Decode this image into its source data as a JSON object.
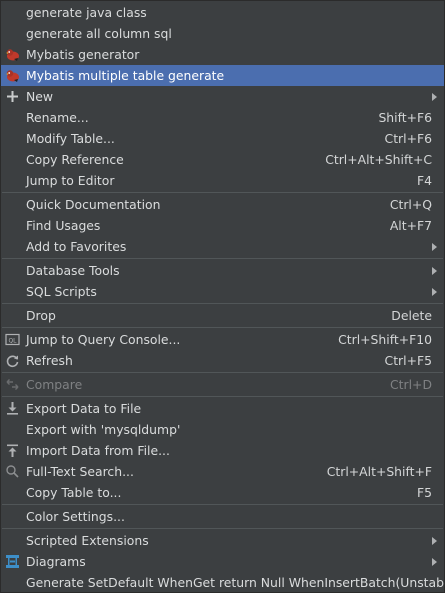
{
  "menu": {
    "items": [
      {
        "label": "generate java class",
        "shortcut": "",
        "icon": "",
        "submenu": false
      },
      {
        "label": "generate all column sql",
        "shortcut": "",
        "icon": "",
        "submenu": false
      },
      {
        "label": "Mybatis generator",
        "shortcut": "",
        "icon": "mybatis-bird-icon",
        "submenu": false
      },
      {
        "label": "Mybatis multiple table generate",
        "shortcut": "",
        "icon": "mybatis-bird-icon",
        "submenu": false,
        "selected": true
      },
      {
        "label": "New",
        "shortcut": "",
        "icon": "plus-icon",
        "submenu": true
      },
      {
        "label": "Rename...",
        "shortcut": "Shift+F6",
        "icon": "",
        "submenu": false
      },
      {
        "label": "Modify Table...",
        "shortcut": "Ctrl+F6",
        "icon": "",
        "submenu": false
      },
      {
        "label": "Copy Reference",
        "shortcut": "Ctrl+Alt+Shift+C",
        "icon": "",
        "submenu": false
      },
      {
        "label": "Jump to Editor",
        "shortcut": "F4",
        "icon": "",
        "submenu": false
      },
      {
        "label": "Quick Documentation",
        "shortcut": "Ctrl+Q",
        "icon": "",
        "submenu": false
      },
      {
        "label": "Find Usages",
        "shortcut": "Alt+F7",
        "icon": "",
        "submenu": false
      },
      {
        "label": "Add to Favorites",
        "shortcut": "",
        "icon": "",
        "submenu": true
      },
      {
        "label": "Database Tools",
        "shortcut": "",
        "icon": "",
        "submenu": true
      },
      {
        "label": "SQL Scripts",
        "shortcut": "",
        "icon": "",
        "submenu": true
      },
      {
        "label": "Drop",
        "shortcut": "Delete",
        "icon": "",
        "submenu": false
      },
      {
        "label": "Jump to Query Console...",
        "shortcut": "Ctrl+Shift+F10",
        "icon": "query-console-icon",
        "submenu": false
      },
      {
        "label": "Refresh",
        "shortcut": "Ctrl+F5",
        "icon": "refresh-icon",
        "submenu": false
      },
      {
        "label": "Compare",
        "shortcut": "Ctrl+D",
        "icon": "compare-icon",
        "submenu": false,
        "disabled": true
      },
      {
        "label": "Export Data to File",
        "shortcut": "",
        "icon": "export-icon",
        "submenu": false
      },
      {
        "label": "Export with 'mysqldump'",
        "shortcut": "",
        "icon": "",
        "submenu": false
      },
      {
        "label": "Import Data from File...",
        "shortcut": "",
        "icon": "import-icon",
        "submenu": false
      },
      {
        "label": "Full-Text Search...",
        "shortcut": "Ctrl+Alt+Shift+F",
        "icon": "search-icon",
        "submenu": false
      },
      {
        "label": "Copy Table to...",
        "shortcut": "F5",
        "icon": "",
        "submenu": false
      },
      {
        "label": "Color Settings...",
        "shortcut": "",
        "icon": "",
        "submenu": false
      },
      {
        "label": "Scripted Extensions",
        "shortcut": "",
        "icon": "",
        "submenu": true
      },
      {
        "label": "Diagrams",
        "shortcut": "",
        "icon": "diagram-icon",
        "submenu": true
      },
      {
        "label": "Generate SetDefault WhenGet return Null WhenInsertBatch(Unstable)",
        "shortcut": "",
        "icon": "",
        "submenu": false
      }
    ]
  },
  "colors": {
    "background": "#3c3f41",
    "selection": "#4b6eaf",
    "separator": "#515658",
    "text": "#dadcdd",
    "disabled_text": "#7f8183"
  }
}
